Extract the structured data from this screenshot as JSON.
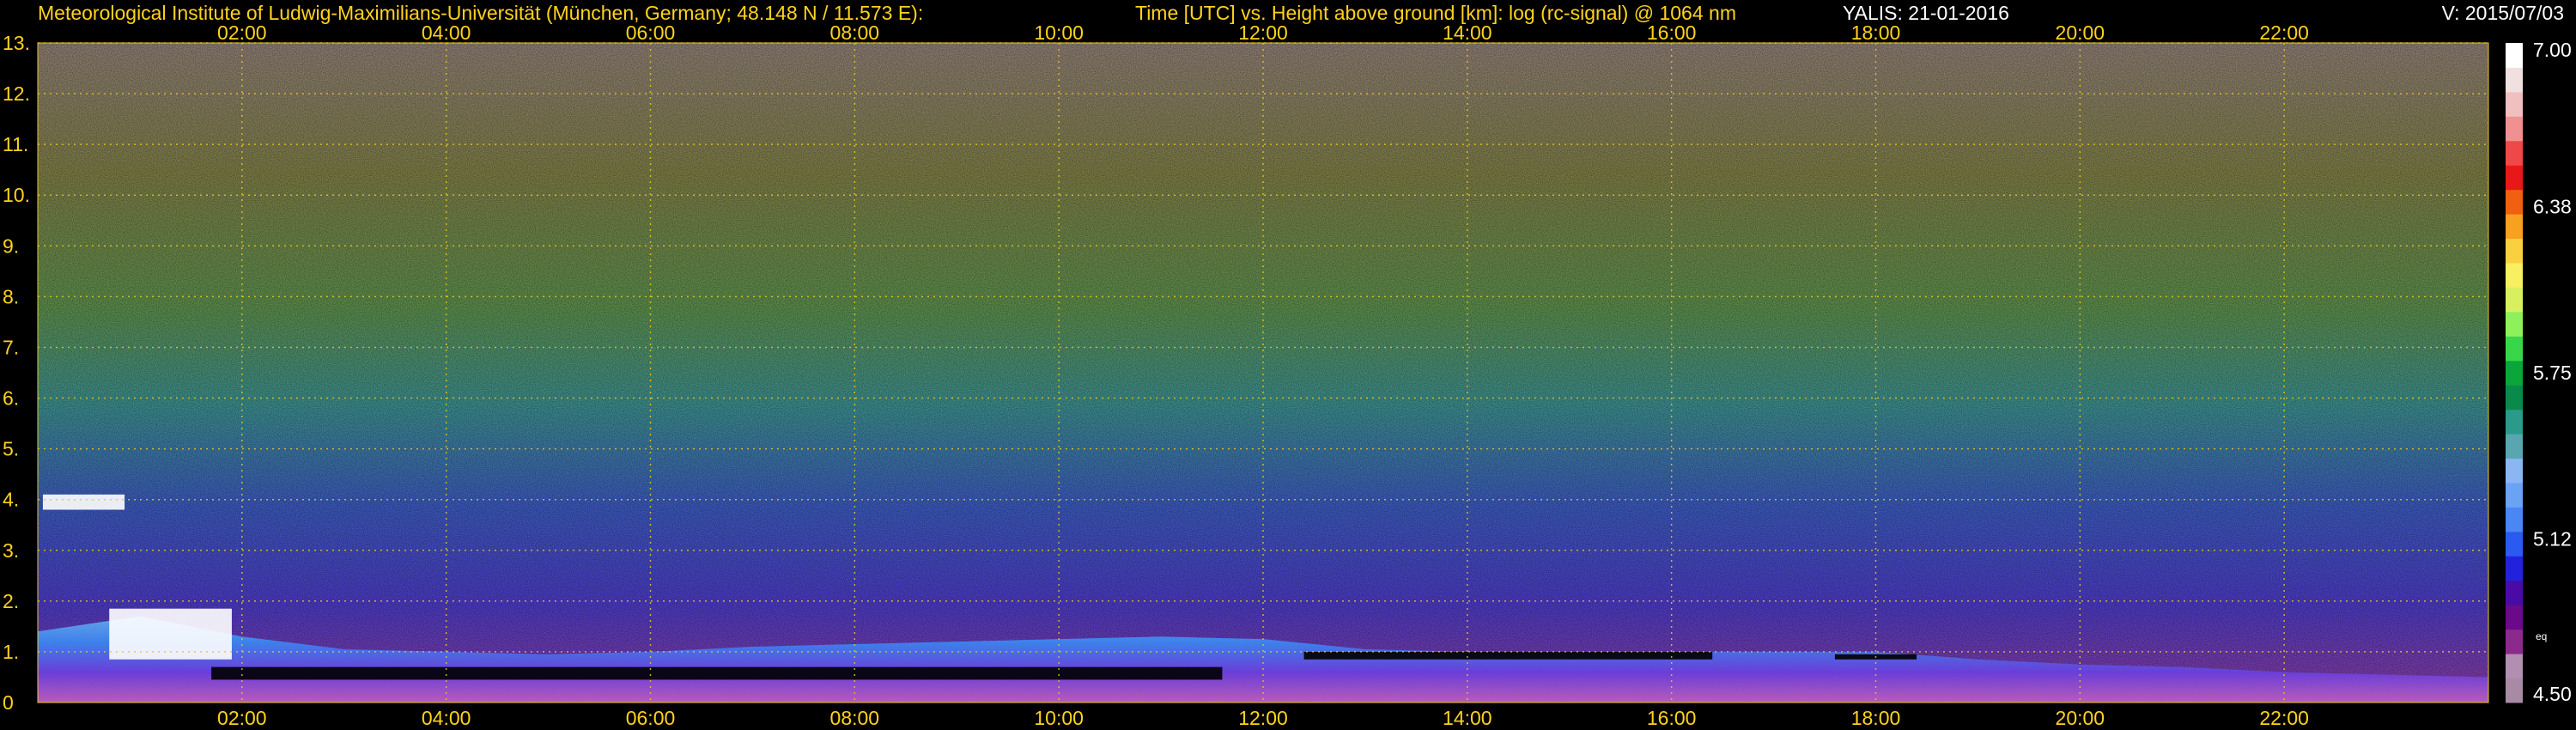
{
  "header": {
    "institute": "Meteorological Institute of Ludwig-Maximilians-Universität (München, Germany; 48.148 N / 11.573 E):",
    "axis_description": "Time [UTC] vs. Height above ground [km]: log (rc-signal) @ 1064 nm",
    "station_date": "YALIS: 21-01-2016",
    "version": "V: 2015/07/03"
  },
  "chart_data": {
    "type": "heatmap",
    "title": "",
    "xlabel": "",
    "ylabel": "",
    "x_unit": "hours UTC",
    "x_range": [
      0,
      24
    ],
    "y_range": [
      0,
      13
    ],
    "x_ticks": [
      {
        "value": 2,
        "label": "02:00"
      },
      {
        "value": 4,
        "label": "04:00"
      },
      {
        "value": 6,
        "label": "06:00"
      },
      {
        "value": 8,
        "label": "08:00"
      },
      {
        "value": 10,
        "label": "10:00"
      },
      {
        "value": 12,
        "label": "12:00"
      },
      {
        "value": 14,
        "label": "14:00"
      },
      {
        "value": 16,
        "label": "16:00"
      },
      {
        "value": 18,
        "label": "18:00"
      },
      {
        "value": 20,
        "label": "20:00"
      },
      {
        "value": 22,
        "label": "22:00"
      }
    ],
    "y_ticks": [
      {
        "value": 0,
        "label": "0"
      },
      {
        "value": 1,
        "label": "1."
      },
      {
        "value": 2,
        "label": "2."
      },
      {
        "value": 3,
        "label": "3."
      },
      {
        "value": 4,
        "label": "4."
      },
      {
        "value": 5,
        "label": "5."
      },
      {
        "value": 6,
        "label": "6."
      },
      {
        "value": 7,
        "label": "7."
      },
      {
        "value": 8,
        "label": "8."
      },
      {
        "value": 9,
        "label": "9."
      },
      {
        "value": 10,
        "label": "10."
      },
      {
        "value": 11,
        "label": "11."
      },
      {
        "value": 12,
        "label": "12."
      },
      {
        "value": 13,
        "label": "13."
      }
    ],
    "grid": true,
    "colorbar": {
      "min": 4.5,
      "max": 7.0,
      "ticks": [
        {
          "value": 7.0,
          "label": "7.00"
        },
        {
          "value": 6.38,
          "label": "6.38"
        },
        {
          "value": 5.75,
          "label": "5.75"
        },
        {
          "value": 5.12,
          "label": "5.12"
        },
        {
          "value": 4.5,
          "label": "4.50"
        }
      ],
      "extra_label": "eq",
      "colors": [
        "#a88aa4",
        "#b28fb0",
        "#8c2a8c",
        "#6a0a8a",
        "#4a0aa6",
        "#2222dd",
        "#2a5af0",
        "#4a86f4",
        "#6aa2f4",
        "#8ab6f2",
        "#5aa6b0",
        "#2a9a8a",
        "#0a8a4a",
        "#0aa63a",
        "#3ad64a",
        "#8ef05a",
        "#d8f060",
        "#f8f060",
        "#f8d040",
        "#f8a020",
        "#f06010",
        "#e81818",
        "#f04848",
        "#f09090",
        "#f0c0c0",
        "#f0e0e0",
        "#ffffff"
      ]
    },
    "features": {
      "aerosol_top_km": [
        1.4,
        1.7,
        1.3,
        1.05,
        1.0,
        0.95,
        1.0,
        1.1,
        1.15,
        1.2,
        1.25,
        1.3,
        1.25,
        1.05,
        1.0,
        1.0,
        1.0,
        1.0,
        1.0,
        0.85,
        0.75,
        0.7,
        0.6,
        0.55,
        0.5
      ],
      "cloud_layers": [
        {
          "start": 0.05,
          "end": 0.85,
          "bottom_km": 3.8,
          "top_km": 4.1,
          "color": "#ffffff"
        },
        {
          "start": 0.7,
          "end": 1.9,
          "bottom_km": 0.85,
          "top_km": 1.85,
          "color": "#ffffff"
        },
        {
          "start": 1.7,
          "end": 11.6,
          "bottom_km": 0.45,
          "top_km": 0.7,
          "color": "#000000"
        },
        {
          "start": 12.4,
          "end": 16.4,
          "bottom_km": 0.85,
          "top_km": 1.0,
          "color": "#000000"
        },
        {
          "start": 17.6,
          "end": 18.4,
          "bottom_km": 0.85,
          "top_km": 0.95,
          "color": "#000000"
        }
      ]
    }
  }
}
